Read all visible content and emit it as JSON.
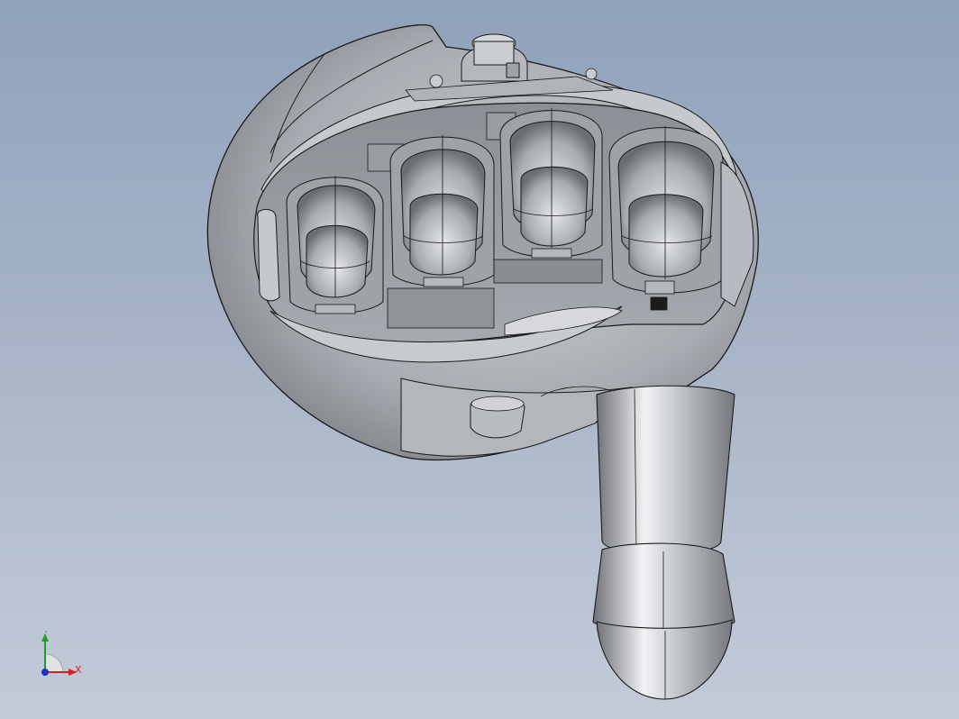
{
  "window": {
    "title": ""
  },
  "viewport": {
    "background_top": "#8fa2bb",
    "background_bottom": "#c3cbd8",
    "render_style": "shaded-with-edges"
  },
  "model": {
    "description_icon": "robotic-hand-model",
    "body_color": "#b9bcc2",
    "edge_color": "#1a1a1a"
  },
  "triad": {
    "x_label": "X",
    "y_label": "Y",
    "x_color": "#d62020",
    "y_color": "#1fa01f",
    "z_color": "#2030c0"
  }
}
